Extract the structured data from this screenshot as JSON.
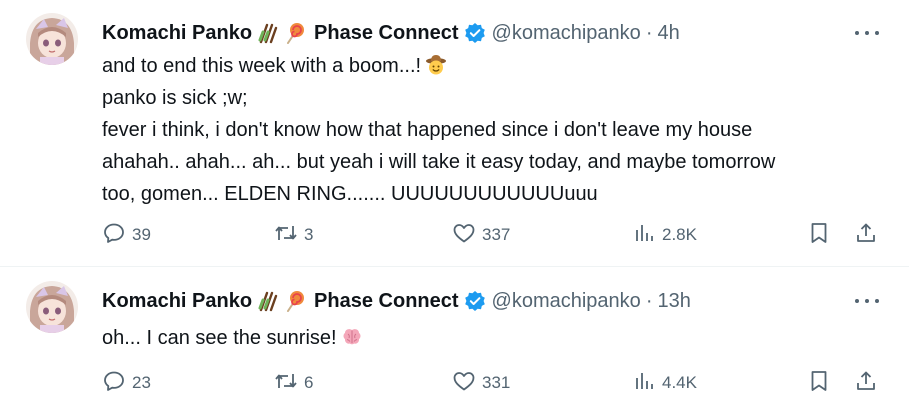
{
  "tweets": [
    {
      "author_name": "Komachi Panko",
      "org": "Phase Connect",
      "handle": "@komachipanko",
      "time": "4h",
      "lines": [
        "and to end this week with a boom...!",
        "panko is sick ;w;",
        "fever i think, i don't know how that happened since i don't leave my house",
        "ahahah.. ahah... ah... but yeah i will take it easy today, and maybe tomorrow",
        "too, gomen... ELDEN RING....... UUUUUUUUUUUUuuu"
      ],
      "line_emoji": "cowboy-hat-face",
      "replies": "39",
      "retweets": "3",
      "likes": "337",
      "views": "2.8K"
    },
    {
      "author_name": "Komachi Panko",
      "org": "Phase Connect",
      "handle": "@komachipanko",
      "time": "13h",
      "lines": [
        "oh... I can see the sunrise!"
      ],
      "line_emoji": "brain",
      "replies": "23",
      "retweets": "6",
      "likes": "331",
      "views": "4.4K"
    }
  ],
  "separator": "·",
  "icons": {
    "name_emoji_1": "pocky-icon",
    "name_emoji_2": "lollipop-icon",
    "verified": "verified-badge-icon",
    "reply": "reply-icon",
    "retweet": "retweet-icon",
    "like": "heart-icon",
    "views": "views-icon",
    "bookmark": "bookmark-icon",
    "share": "share-icon",
    "more": "more-icon"
  },
  "colors": {
    "text": "#0f1419",
    "secondary": "#536471",
    "verified_blue": "#1d9bf0",
    "divider": "#eff3f4"
  }
}
